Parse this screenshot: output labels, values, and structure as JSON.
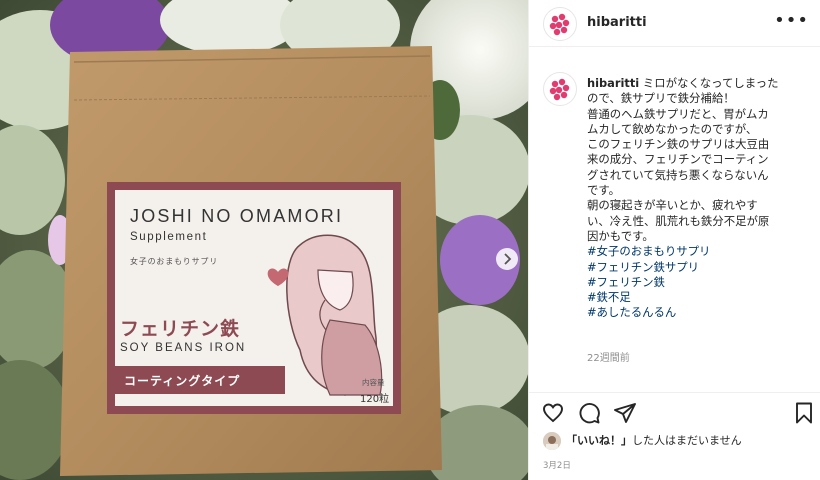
{
  "post": {
    "username": "hibaritti",
    "more_icon": "more-horizontal-icon",
    "caption": {
      "username": "hibaritti",
      "lines": [
        "ミロがなくなってしまった",
        "ので、鉄サプリで鉄分補給！",
        "普通のヘム鉄サプリだと、胃がムカ",
        "ムカして飲めなかったのですが、",
        "このフェリチン鉄のサプリは大豆由",
        "来の成分、フェリチンでコーティン",
        "グされていて気持ち悪くならないん",
        "です。",
        "朝の寝起きが辛いとか、疲れやす",
        "い、冷え性、肌荒れも鉄分不足が原",
        "因かもです。"
      ],
      "hashtags": [
        "#女子のおまもりサプリ",
        "#フェリチン鉄サプリ",
        "#フェリチン鉄",
        "#鉄不足",
        "#あしたるんるん"
      ]
    },
    "time_ago": "22週間前",
    "likes_bold": "「いいね！」",
    "likes_rest": "した人はまだいません",
    "date": "3月2日"
  },
  "product": {
    "brand": "JOSHI NO OMAMORI",
    "subtitle": "Supplement",
    "jp_brand": "女子のおまもりサプリ",
    "name_jp": "フェリチン鉄",
    "name_en": "SOY BEANS IRON",
    "type_label": "コーティングタイプ",
    "capacity_label": "内容量",
    "count": "120粒"
  },
  "colors": {
    "kraft": "#b08a5e",
    "label_accent": "#8e4a52",
    "link": "#00376b",
    "text": "#262626",
    "muted": "#8e8e8e"
  },
  "icons": [
    "heart-icon",
    "comment-icon",
    "share-icon",
    "bookmark-icon",
    "chevron-right-icon"
  ]
}
